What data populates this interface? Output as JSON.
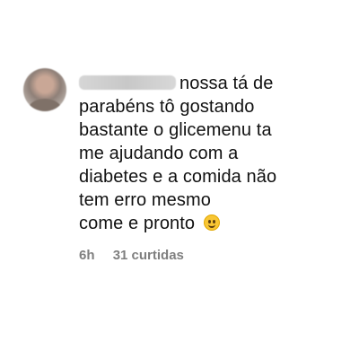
{
  "comment": {
    "text_lines": [
      "nossa tá de",
      "parabéns tô gostando",
      "bastante o glicemenu ta",
      "me ajudando com a",
      "diabetes e a comida não",
      "tem erro mesmo",
      "come e pronto"
    ],
    "time": "6h",
    "likes": "31 curtidas",
    "emoji_name": "smiling-face-icon"
  }
}
